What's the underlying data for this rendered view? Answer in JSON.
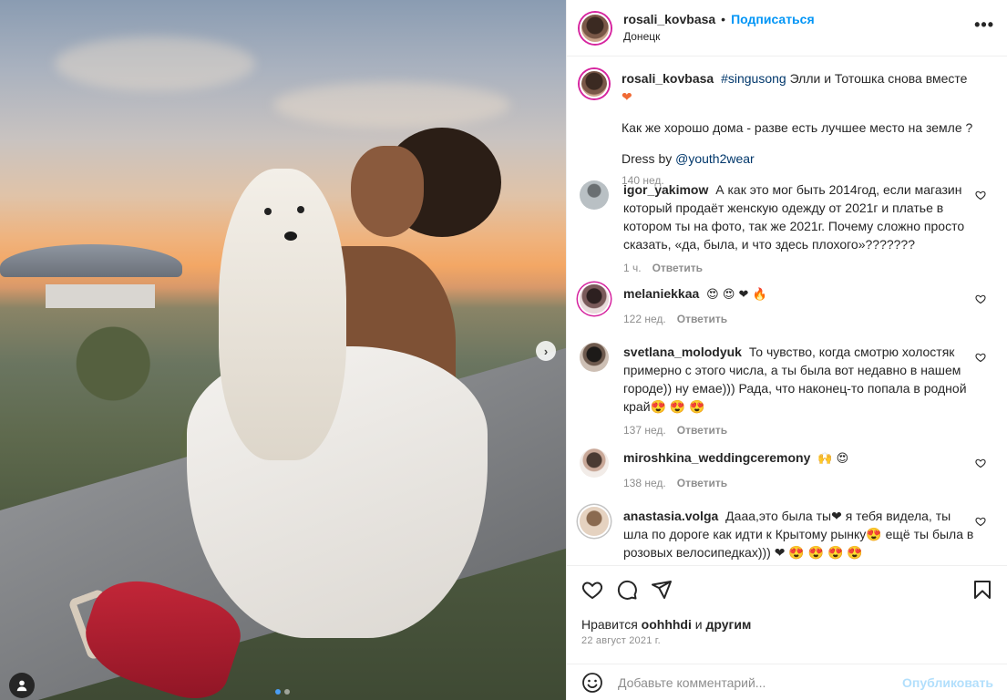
{
  "post": {
    "author": "rosali_kovbasa",
    "follow_label": "Подписаться",
    "separator": "•",
    "location": "Донецк",
    "more_label": "•••",
    "caption": {
      "hashtag": "#singusong",
      "text": " Элли и Тотошка снова вместе ",
      "heart": "❤",
      "line2": "Как же хорошо дома - разве есть лучшее место на земле ?",
      "line3_prefix": "Dress by ",
      "mention": "@youth2wear",
      "time": "140 нед."
    }
  },
  "comments": [
    {
      "user": "igor_yakimow",
      "text": "А как это мог быть 2014год, если магазин который продаёт женскую одежду от 2021г и платье в котором ты на фото, так же 2021г. Почему сложно просто сказать, «да, была, и что здесь плохого»???????",
      "time": "1 ч.",
      "reply": "Ответить",
      "avatar_color": "#9aa3a8"
    },
    {
      "user": "melaniekkaa",
      "text": "😍 😍 ❤ 🔥",
      "time": "122 нед.",
      "reply": "Ответить",
      "avatar_color": "#3a2a2a"
    },
    {
      "user": "svetlana_molodyuk",
      "text": "То чувство, когда смотрю холостяк примерно с этого числа, а ты была вот недавно в нашем городе)) ну емае))) Рада, что наконец-то попала в родной край😍 😍 😍",
      "time": "137 нед.",
      "reply": "Ответить",
      "avatar_color": "#2a2622"
    },
    {
      "user": "miroshkina_weddingceremony",
      "text": "🙌 😍",
      "time": "138 нед.",
      "reply": "Ответить",
      "avatar_color": "#c9b7ac"
    },
    {
      "user": "anastasia.volga",
      "text": "Дааа,это была ты❤  я тебя видела, ты шла по дороге как идти к Крытому рынку😍  ещё ты была в розовых велосипедках))) ❤ 😍 😍 😍 😍",
      "time": "",
      "reply": "",
      "avatar_color": "#d8c4b0"
    }
  ],
  "actions": {
    "likes_prefix": "Нравится ",
    "likes_user": "oohhhdi",
    "likes_suffix": " и ",
    "likes_others": "другим",
    "date": "22 август 2021 г."
  },
  "add_comment": {
    "placeholder": "Добавьте комментарий...",
    "publish_label": "Опубликовать"
  },
  "icons": [
    "user-tag-icon",
    "next-arrow-icon",
    "more-icon",
    "heart-icon",
    "comment-icon",
    "share-icon",
    "bookmark-icon",
    "emoji-icon"
  ],
  "colors": {
    "accent": "#0095f6",
    "publish_disabled": "#b2dffc",
    "meta_gray": "#8e8e8e",
    "like_red": "#ed4956"
  }
}
